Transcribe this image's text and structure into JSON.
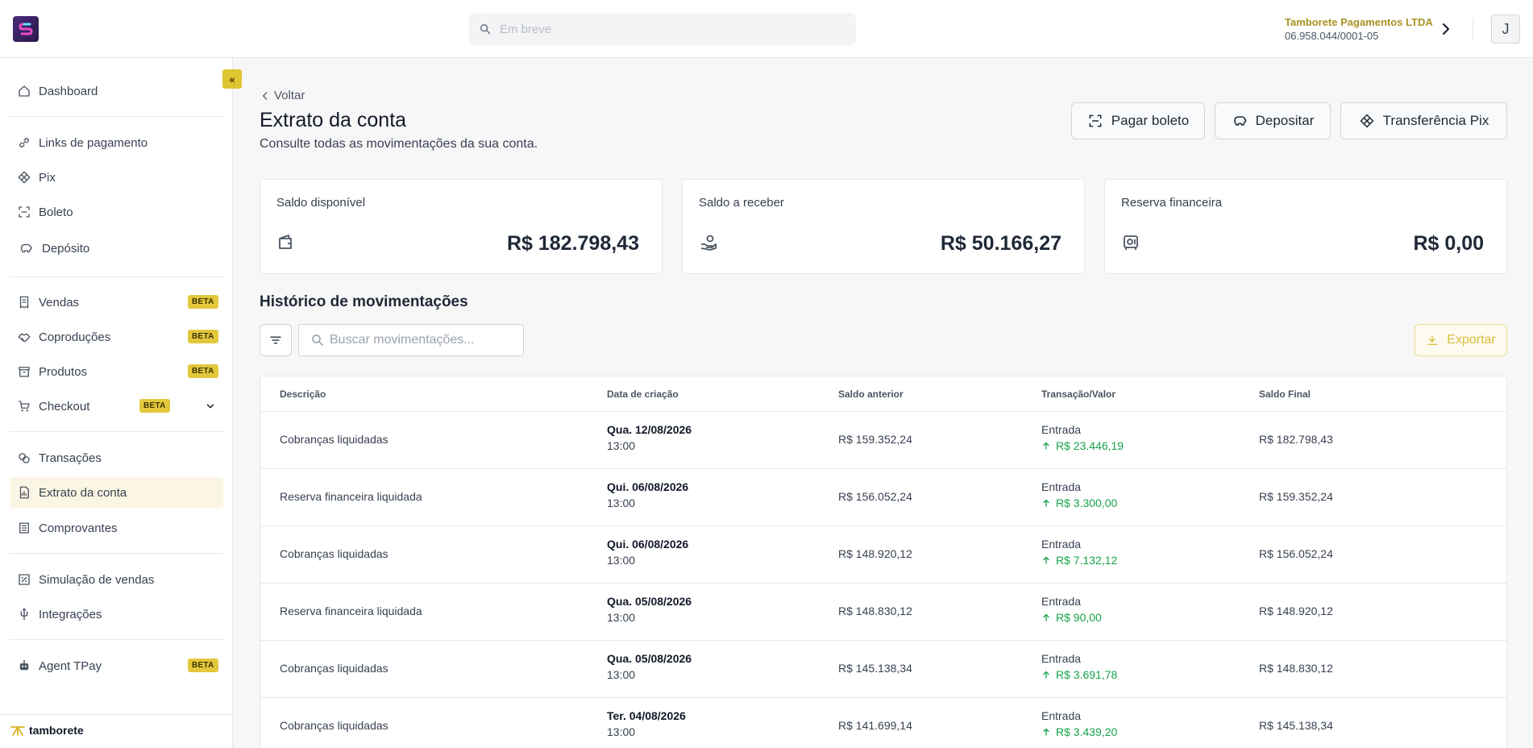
{
  "header": {
    "search_placeholder": "Em breve",
    "company_name": "Tamborete Pagamentos LTDA",
    "company_cnpj": "06.958.044/0001-05",
    "avatar_initial": "J"
  },
  "sidebar": {
    "items": [
      {
        "label": "Dashboard",
        "icon": "home-icon"
      },
      {
        "label": "Links de pagamento",
        "icon": "link-icon"
      },
      {
        "label": "Pix",
        "icon": "pix-icon"
      },
      {
        "label": "Boleto",
        "icon": "scan-icon"
      },
      {
        "label": "Depósito",
        "icon": "piggy-bank-icon"
      },
      {
        "label": "Vendas",
        "icon": "receipt-icon",
        "badge": "BETA"
      },
      {
        "label": "Coproduções",
        "icon": "handshake-icon",
        "badge": "BETA"
      },
      {
        "label": "Produtos",
        "icon": "box-icon",
        "badge": "BETA"
      },
      {
        "label": "Checkout",
        "icon": "cart-icon",
        "badge": "BETA"
      },
      {
        "label": "Transações",
        "icon": "transactions-icon"
      },
      {
        "label": "Extrato da conta",
        "icon": "statement-icon",
        "active": true
      },
      {
        "label": "Comprovantes",
        "icon": "list-icon"
      },
      {
        "label": "Simulação de vendas",
        "icon": "percent-icon"
      },
      {
        "label": "Integrações",
        "icon": "plug-icon"
      },
      {
        "label": "Agent TPay",
        "icon": "robot-icon",
        "badge": "BETA"
      }
    ],
    "collapse_label": "«",
    "brand": "tamborete"
  },
  "page": {
    "back_label": "Voltar",
    "title": "Extrato da conta",
    "subtitle": "Consulte todas as movimentações da sua conta.",
    "actions": {
      "pay_boleto": "Pagar boleto",
      "deposit": "Depositar",
      "pix_transfer": "Transferência Pix"
    }
  },
  "cards": [
    {
      "label": "Saldo disponível",
      "value": "R$ 182.798,43",
      "icon": "wallet-icon"
    },
    {
      "label": "Saldo a receber",
      "value": "R$ 50.166,27",
      "icon": "hand-coin-icon"
    },
    {
      "label": "Reserva financeira",
      "value": "R$ 0,00",
      "icon": "safe-icon"
    }
  ],
  "history": {
    "title": "Histórico de movimentações",
    "search_placeholder": "Buscar movimentações...",
    "export_label": "Exportar",
    "columns": [
      "Descrição",
      "Data de criação",
      "Saldo anterior",
      "Transação/Valor",
      "Saldo Final"
    ],
    "rows": [
      {
        "desc": "Cobranças liquidadas",
        "date": "Qua. 12/08/2026",
        "time": "13:00",
        "prev": "R$ 159.352,24",
        "type": "Entrada",
        "amount": "R$ 23.446,19",
        "final": "R$ 182.798,43"
      },
      {
        "desc": "Reserva financeira liquidada",
        "date": "Qui. 06/08/2026",
        "time": "13:00",
        "prev": "R$ 156.052,24",
        "type": "Entrada",
        "amount": "R$ 3.300,00",
        "final": "R$ 159.352,24"
      },
      {
        "desc": "Cobranças liquidadas",
        "date": "Qui. 06/08/2026",
        "time": "13:00",
        "prev": "R$ 148.920,12",
        "type": "Entrada",
        "amount": "R$ 7.132,12",
        "final": "R$ 156.052,24"
      },
      {
        "desc": "Reserva financeira liquidada",
        "date": "Qua. 05/08/2026",
        "time": "13:00",
        "prev": "R$ 148.830,12",
        "type": "Entrada",
        "amount": "R$ 90,00",
        "final": "R$ 148.920,12"
      },
      {
        "desc": "Cobranças liquidadas",
        "date": "Qua. 05/08/2026",
        "time": "13:00",
        "prev": "R$ 145.138,34",
        "type": "Entrada",
        "amount": "R$ 3.691,78",
        "final": "R$ 148.830,12"
      },
      {
        "desc": "Cobranças liquidadas",
        "date": "Ter. 04/08/2026",
        "time": "13:00",
        "prev": "R$ 141.699,14",
        "type": "Entrada",
        "amount": "R$ 3.439,20",
        "final": "R$ 145.138,34"
      }
    ]
  },
  "colors": {
    "accent": "#e3c83d",
    "company_name": "#a89224",
    "positive": "#16a34a"
  }
}
